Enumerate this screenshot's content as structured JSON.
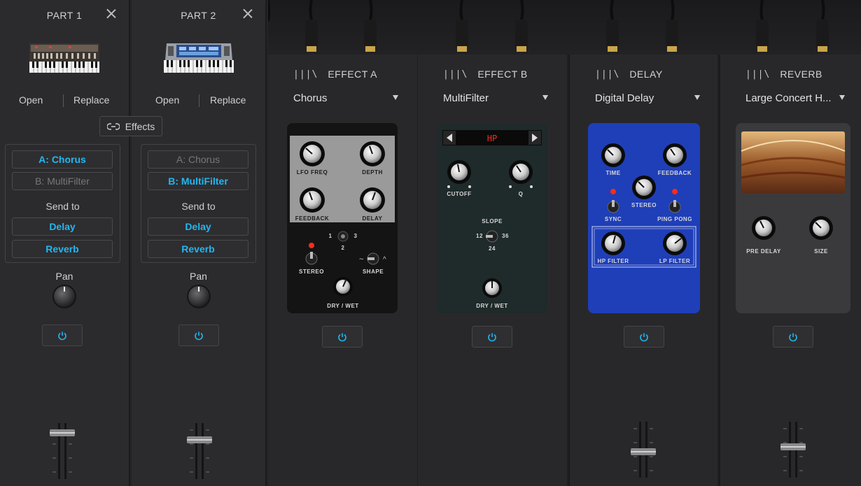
{
  "parts": [
    {
      "title": "PART 1",
      "open_label": "Open",
      "replace_label": "Replace",
      "effect_a": "A: Chorus",
      "effect_b": "B: MultiFilter",
      "send_to_label": "Send to",
      "send_delay": "Delay",
      "send_reverb": "Reverb",
      "pan_label": "Pan"
    },
    {
      "title": "PART 2",
      "open_label": "Open",
      "replace_label": "Replace",
      "effect_a": "A: Chorus",
      "effect_b": "B: MultiFilter",
      "send_to_label": "Send to",
      "send_delay": "Delay",
      "send_reverb": "Reverb",
      "pan_label": "Pan"
    }
  ],
  "effects_chip_label": "Effects",
  "slots": [
    {
      "header": "EFFECT A",
      "preset": "Chorus",
      "knobs": [
        "LFO FREQ",
        "DEPTH",
        "FEEDBACK",
        "DELAY"
      ],
      "controls": [
        "STEREO",
        "SHAPE",
        "DRY / WET"
      ],
      "switch_labels": [
        "1",
        "2",
        "3"
      ]
    },
    {
      "header": "EFFECT B",
      "preset": "MultiFilter",
      "display": "HP",
      "knobs": [
        "CUTOFF",
        "Q"
      ],
      "slope_label": "SLOPE",
      "slope_values": [
        "12",
        "24",
        "36"
      ],
      "mix_label": "DRY / WET"
    },
    {
      "header": "DELAY",
      "preset": "Digital Delay",
      "knobs": [
        "TIME",
        "FEEDBACK",
        "STEREO",
        "SYNC",
        "PING PONG",
        "HP FILTER",
        "LP FILTER"
      ]
    },
    {
      "header": "REVERB",
      "preset": "Large Concert H...",
      "knobs": [
        "PRE DELAY",
        "SIZE"
      ]
    }
  ],
  "colors": {
    "accent": "#23b7f0",
    "delay_pedal": "#1f3fb8",
    "led_red": "#ff2a1a"
  }
}
